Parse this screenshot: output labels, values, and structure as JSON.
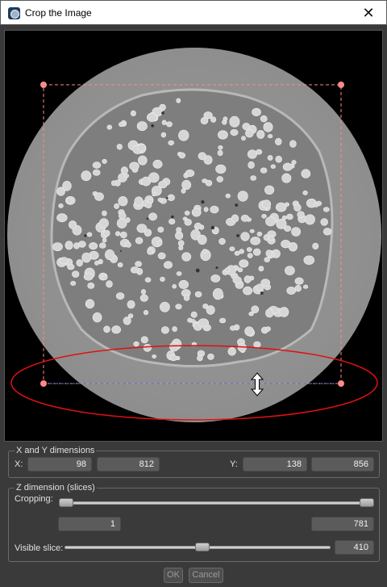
{
  "window": {
    "title": "Crop the Image",
    "close_glyph": "✕",
    "icon": "app-icon"
  },
  "xy_group": {
    "title": "X and Y dimensions",
    "x_label": "X:",
    "x_min": "98",
    "x_max": "812",
    "y_label": "Y:",
    "y_min": "138",
    "y_max": "856"
  },
  "z_group": {
    "title": "Z dimension (slices)",
    "cropping_label": "Cropping:",
    "slice_min": "1",
    "slice_max": "781",
    "visible_label": "Visible slice:",
    "visible_value": "410"
  },
  "buttons": {
    "ok": "OK",
    "cancel": "Cancel"
  },
  "colors": {
    "crop_rect": "#ff8a8a",
    "crop_bottom_line": "#4a7fd8",
    "annotation_ellipse": "#e01010"
  },
  "icons": {
    "resize_cursor": "vertical-resize-cursor-icon"
  }
}
